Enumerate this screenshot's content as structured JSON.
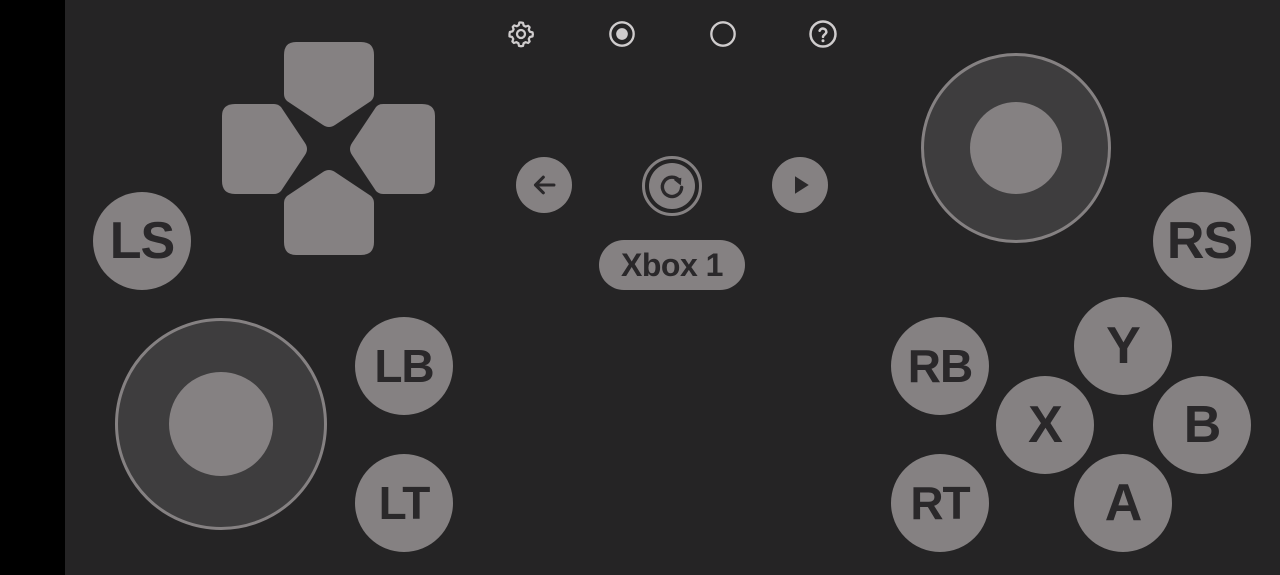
{
  "colors": {
    "background": "#252425",
    "left_bar": "#000000",
    "button_fill": "#858182",
    "button_text": "#2a282a",
    "stick_base": "#3e3d3e",
    "icon_color": "#cfcccd"
  },
  "toolbar": {
    "icons": [
      "gear-icon",
      "radio-checked-icon",
      "radio-unchecked-icon",
      "help-icon"
    ]
  },
  "dpad": {
    "directions": [
      "up",
      "left",
      "right",
      "down"
    ]
  },
  "sticks": {
    "left": {
      "label": "LS"
    },
    "right": {
      "label": "RS"
    }
  },
  "shoulders": {
    "lb": "LB",
    "lt": "LT",
    "rb": "RB",
    "rt": "RT"
  },
  "face_buttons": {
    "y": "Y",
    "x": "X",
    "b": "B",
    "a": "A"
  },
  "center": {
    "nav_icons": [
      "arrow-left-icon",
      "refresh-icon",
      "play-icon"
    ],
    "controller_name": "Xbox 1"
  }
}
